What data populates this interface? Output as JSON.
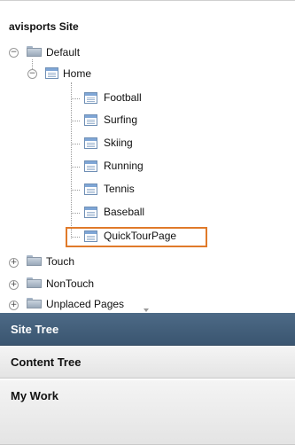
{
  "tree": {
    "title": "avisports Site",
    "root": {
      "label": "Default",
      "toggle": "−",
      "home": {
        "label": "Home",
        "toggle": "−",
        "children": [
          {
            "label": "Football"
          },
          {
            "label": "Surfing"
          },
          {
            "label": "Skiing"
          },
          {
            "label": "Running"
          },
          {
            "label": "Tennis"
          },
          {
            "label": "Baseball"
          },
          {
            "label": "QuickTourPage",
            "highlighted": true
          }
        ]
      }
    },
    "other_folders": [
      {
        "label": "Touch",
        "toggle": "+"
      },
      {
        "label": "NonTouch",
        "toggle": "+"
      },
      {
        "label": "Unplaced Pages",
        "toggle": "+"
      }
    ]
  },
  "accordion": {
    "items": [
      {
        "label": "Site Tree",
        "active": true
      },
      {
        "label": "Content Tree",
        "active": false
      },
      {
        "label": "My Work",
        "active": false
      }
    ]
  },
  "colors": {
    "active_header": "#41607d",
    "highlight_border": "#e07a2a"
  }
}
